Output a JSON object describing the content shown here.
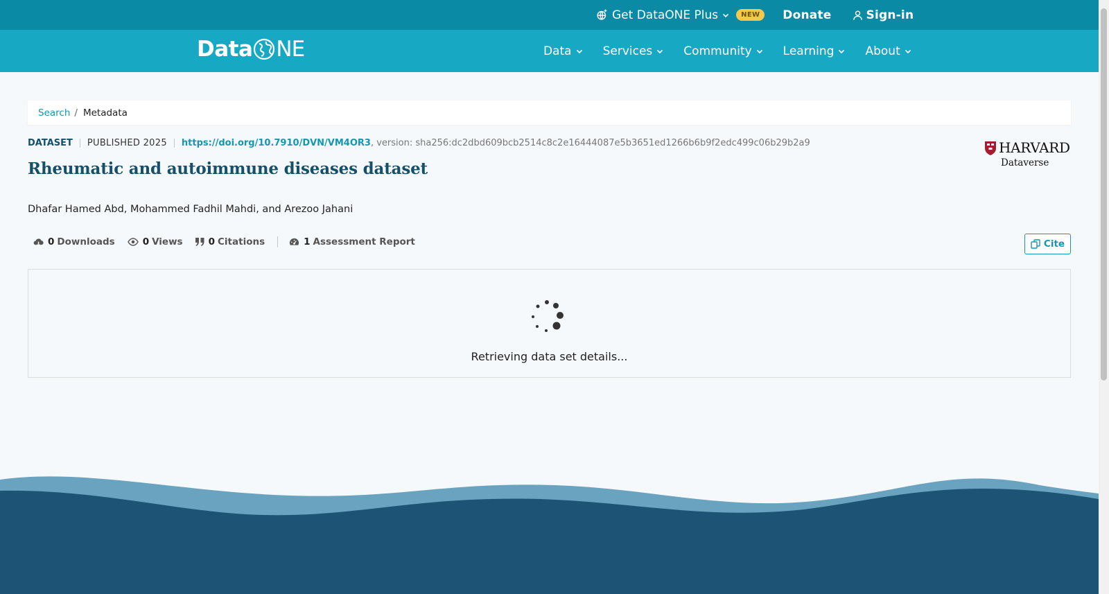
{
  "topbar": {
    "plus_label": "Get DataONE Plus",
    "new_badge": "NEW",
    "donate_label": "Donate",
    "signin_label": "Sign-in"
  },
  "nav": {
    "logo_text_a": "Data",
    "logo_text_b": "NE",
    "items": [
      {
        "label": "Data"
      },
      {
        "label": "Services"
      },
      {
        "label": "Community"
      },
      {
        "label": "Learning"
      },
      {
        "label": "About"
      }
    ]
  },
  "breadcrumb": {
    "search_label": "Search",
    "separator": "/",
    "current": "Metadata"
  },
  "dataset": {
    "type": "DATASET",
    "published": "PUBLISHED 2025",
    "doi": "https://doi.org/10.7910/DVN/VM4OR3",
    "version": ", version: sha256:dc2dbd609bcb2514c8c2e16444087e5b3651ed1266b6b9f2edc499c06b29b2a9",
    "title": "Rheumatic and autoimmune diseases dataset",
    "authors": "Dhafar Hamed Abd, Mohammed Fadhil Mahdi, and Arezoo Jahani",
    "repository_name": "HARVARD",
    "repository_sub": "Dataverse"
  },
  "stats": {
    "downloads_count": "0",
    "downloads_label": "Downloads",
    "views_count": "0",
    "views_label": "Views",
    "citations_count": "0",
    "citations_label": "Citations",
    "assessment_count": "1",
    "assessment_label": "Assessment Report"
  },
  "cite_label": "Cite",
  "loading_text": "Retrieving data set details...",
  "colors": {
    "topbar": "#0b8aa6",
    "nav": "#17a8c4",
    "title": "#15506b",
    "link": "#1597b0",
    "badge": "#f2c94c",
    "wave_light": "#6aa3bf",
    "wave_dark": "#1d5476"
  },
  "icons": {
    "plus": "globe-sparkle-icon",
    "signin": "user-icon",
    "downloads": "cloud-download-icon",
    "views": "eye-icon",
    "citations": "quote-icon",
    "assessment": "gauge-icon",
    "cite": "copy-icon",
    "loading": "spinner-icon"
  }
}
